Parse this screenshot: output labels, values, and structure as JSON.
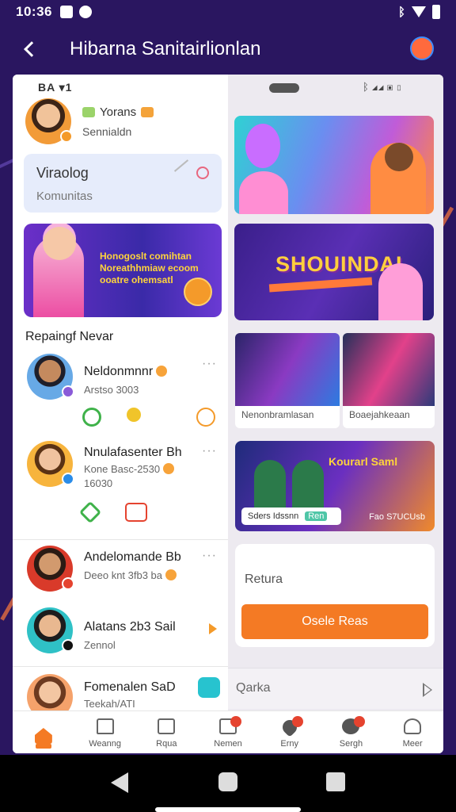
{
  "status_bar": {
    "time": "10:36"
  },
  "header": {
    "title": "Hibarna Sanitairlionlan"
  },
  "inner_status": {
    "left": "BA ▾1",
    "right": ""
  },
  "profile": {
    "name": "Yorans",
    "subtitle": "Sennialdn"
  },
  "info_card": {
    "title": "Viraolog",
    "subtitle": "Komunitas"
  },
  "promo": {
    "text": "Honogoslt comihtan Noreathhmiaw ecoom ooatre ohemsatl"
  },
  "section_title": "Repaingf Nevar",
  "contacts": [
    {
      "name": "Neldonmnnr",
      "sub": "Arstso 3003"
    },
    {
      "name": "Nnulafasenter Bh",
      "sub": "Kone Basc-2530",
      "sub2": "16030"
    },
    {
      "name": "Andelomande Bb",
      "sub": "Deeo knt 3fb3 ba"
    },
    {
      "name": "Alatans 2b3 Sail",
      "sub": "Zennol"
    },
    {
      "name": "Fomenalen SaD",
      "sub": "Teekah/ATI"
    }
  ],
  "media": {
    "banner_title": "SHOUINDAI",
    "card3_caption": "Nenonbramlasan",
    "card4_caption": "Boaejahkeaan",
    "card5_title": "Kourarl Saml",
    "card5_caption": "Sders Idssnn",
    "card5_tag": "Ren",
    "card5_right": "Fao S7UCUsb"
  },
  "form": {
    "label": "Retura",
    "button": "Osele Reas"
  },
  "quick": {
    "label": "Qarka"
  },
  "tabs": [
    {
      "label": "",
      "active": true
    },
    {
      "label": "Weanng"
    },
    {
      "label": "Rqua"
    },
    {
      "label": "Nemen",
      "badge": ""
    },
    {
      "label": "Erny",
      "badge": ""
    },
    {
      "label": "Sergh",
      "badge": ""
    },
    {
      "label": "Meer"
    }
  ],
  "colors": {
    "accent": "#f47a24",
    "header_bg": "#2a1660",
    "badge": "#e5432f"
  }
}
